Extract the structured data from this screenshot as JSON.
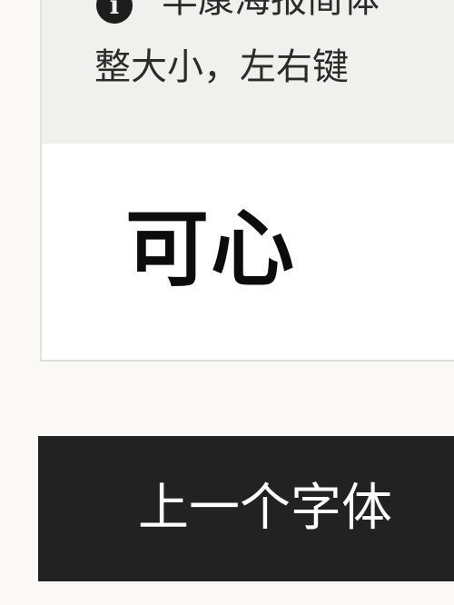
{
  "info": {
    "icon": "info-icon",
    "line1": "羊康海报简体",
    "line2": "整大小，左右键"
  },
  "preview": {
    "text": "可心"
  },
  "actions": {
    "prev_font_label": "上一个字体"
  },
  "colors": {
    "page_background": "#faf9f5",
    "info_background": "#f0f0ef",
    "preview_background": "#ffffff",
    "button_background": "#222222",
    "button_text": "#ffffff"
  }
}
